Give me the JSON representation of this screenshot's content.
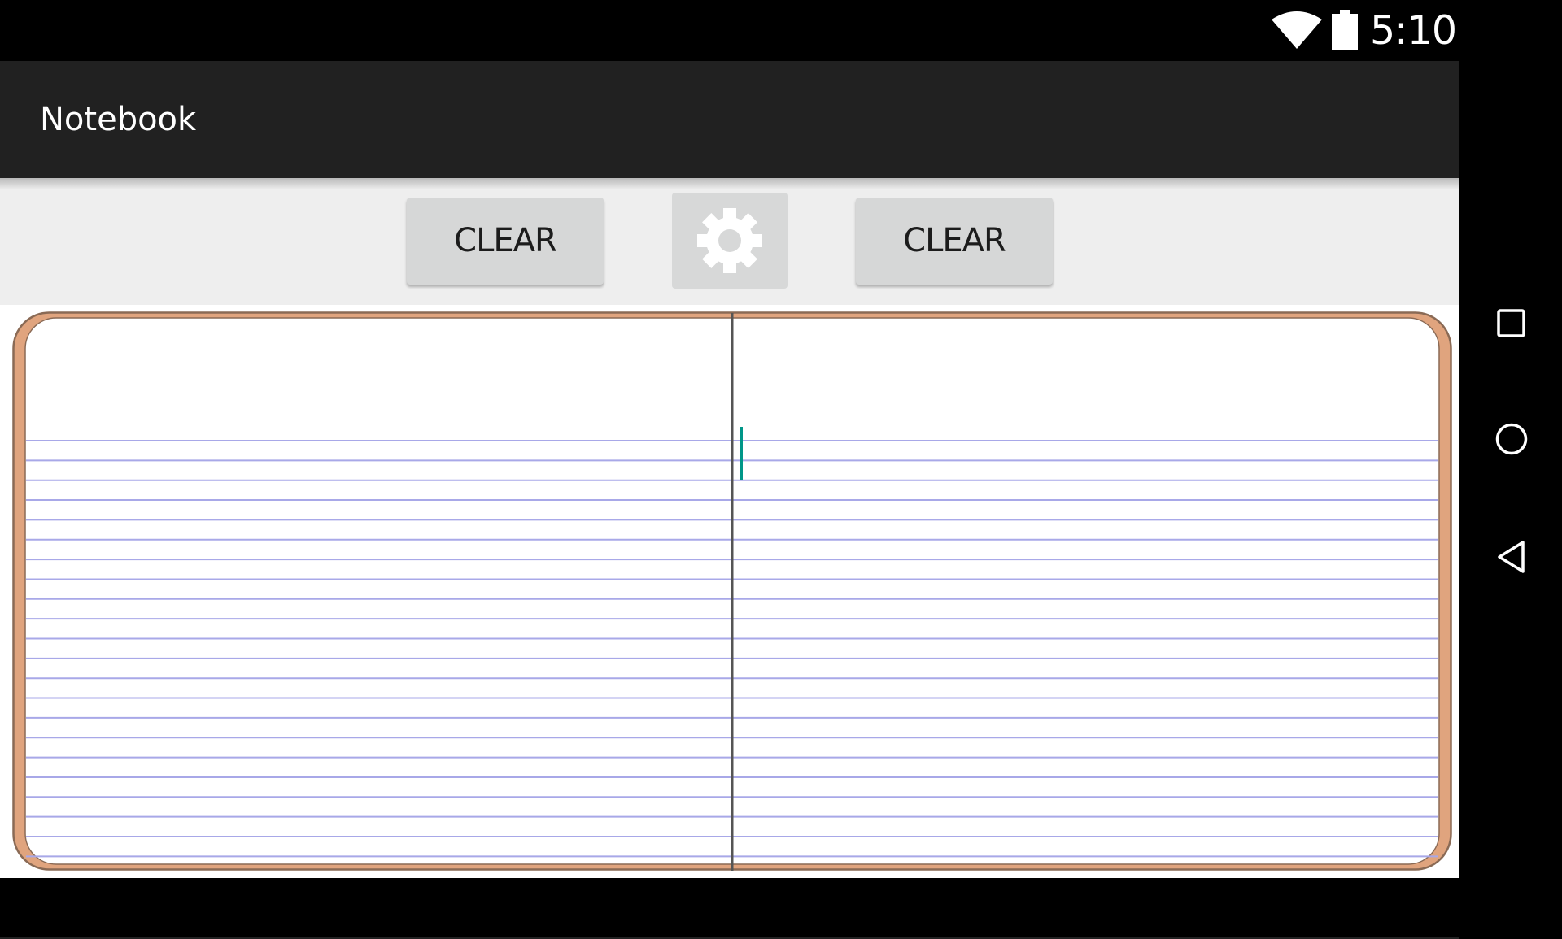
{
  "status_bar": {
    "time": "5:10",
    "icons": [
      "wifi-icon",
      "battery-icon"
    ]
  },
  "app": {
    "title": "Notebook"
  },
  "toolbar": {
    "clear_left_label": "CLEAR",
    "settings_icon": "gear-icon",
    "clear_right_label": "CLEAR"
  },
  "notebook": {
    "pages": [
      "left-page",
      "right-page"
    ],
    "ruled_lines": 24,
    "left_text": "",
    "right_text": "",
    "cursor_page": "right",
    "colors": {
      "cover": "#E0A47E",
      "cover_outline": "#8A6A55",
      "rule": "#A8A8E8",
      "spine": "#555555",
      "cursor": "#009688"
    }
  },
  "nav_bar": {
    "buttons": [
      "recents",
      "home",
      "back"
    ]
  }
}
